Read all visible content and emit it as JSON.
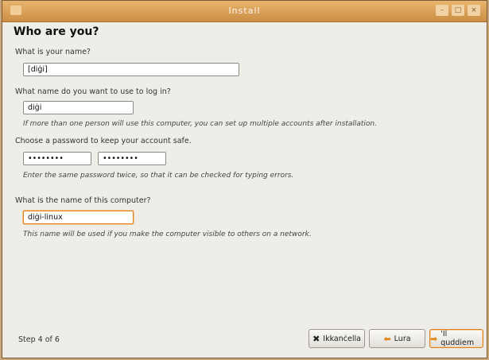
{
  "window": {
    "title": "Install",
    "controls": [
      "–",
      "□",
      "×"
    ]
  },
  "page": {
    "heading": "Who are you?"
  },
  "form": {
    "name_label": "What is your name?",
    "name_value": "[diġi]",
    "login_label": "What name do you want to use to log in?",
    "login_value": "diġi",
    "login_hint": "If more than one person will use this computer, you can set up multiple accounts after installation.",
    "password_label": "Choose a password to keep your account safe.",
    "password_value": "••••••••",
    "password_confirm_value": "••••••••",
    "password_hint": "Enter the same password twice, so that it can be checked for typing errors.",
    "computer_label": "What is the name of this computer?",
    "computer_value": "diġi-linux",
    "computer_hint": "This name will be used if you make the computer visible to others on a network."
  },
  "footer": {
    "step": "Step 4 of 6",
    "cancel_label": "Ikkanċella",
    "back_label": "Lura",
    "forward_label": "'Il quddiem",
    "cancel_icon": "close-icon",
    "back_icon": "back-arrow-icon",
    "forward_icon": "forward-arrow-icon",
    "accent_color": "#e08a1e"
  }
}
